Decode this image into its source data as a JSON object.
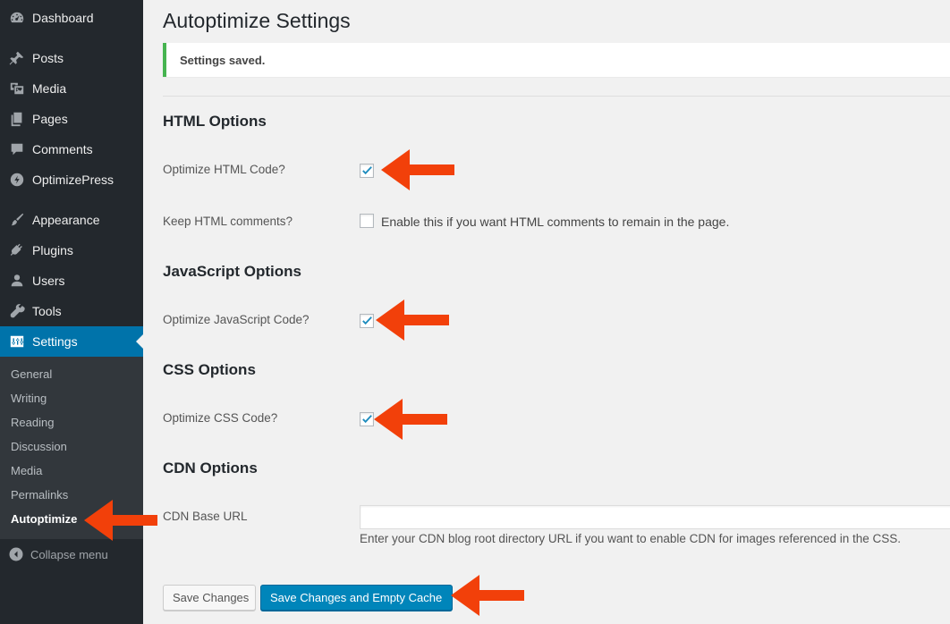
{
  "sidebar": {
    "menu": [
      {
        "label": "Dashboard",
        "icon": "dashboard-icon"
      },
      {
        "label": "Posts",
        "icon": "pin-icon"
      },
      {
        "label": "Media",
        "icon": "media-icon"
      },
      {
        "label": "Pages",
        "icon": "pages-icon"
      },
      {
        "label": "Comments",
        "icon": "comment-icon"
      },
      {
        "label": "OptimizePress",
        "icon": "optimizepress-icon"
      },
      {
        "label": "Appearance",
        "icon": "brush-icon"
      },
      {
        "label": "Plugins",
        "icon": "plugin-icon"
      },
      {
        "label": "Users",
        "icon": "user-icon"
      },
      {
        "label": "Tools",
        "icon": "wrench-icon"
      },
      {
        "label": "Settings",
        "icon": "settings-icon"
      }
    ],
    "submenu": [
      "General",
      "Writing",
      "Reading",
      "Discussion",
      "Media",
      "Permalinks",
      "Autoptimize"
    ],
    "collapse_label": "Collapse menu"
  },
  "page": {
    "title": "Autoptimize Settings",
    "notice": "Settings saved."
  },
  "sections": {
    "html": {
      "heading": "HTML Options",
      "optimize_label": "Optimize HTML Code?",
      "optimize_checked": true,
      "keep_comments_label": "Keep HTML comments?",
      "keep_comments_checked": false,
      "keep_comments_desc": "Enable this if you want HTML comments to remain in the page."
    },
    "js": {
      "heading": "JavaScript Options",
      "optimize_label": "Optimize JavaScript Code?",
      "optimize_checked": true
    },
    "css": {
      "heading": "CSS Options",
      "optimize_label": "Optimize CSS Code?",
      "optimize_checked": true
    },
    "cdn": {
      "heading": "CDN Options",
      "base_url_label": "CDN Base URL",
      "base_url_value": "",
      "description": "Enter your CDN blog root directory URL if you want to enable CDN for images referenced in the CSS."
    }
  },
  "buttons": {
    "save": "Save Changes",
    "save_empty": "Save Changes and Empty Cache"
  },
  "colors": {
    "sidebar_bg": "#23282d",
    "submenu_bg": "#32373c",
    "accent": "#0073aa",
    "primary_button": "#0085ba",
    "notice_success": "#46b450",
    "annotation_arrow": "#f2400a"
  }
}
